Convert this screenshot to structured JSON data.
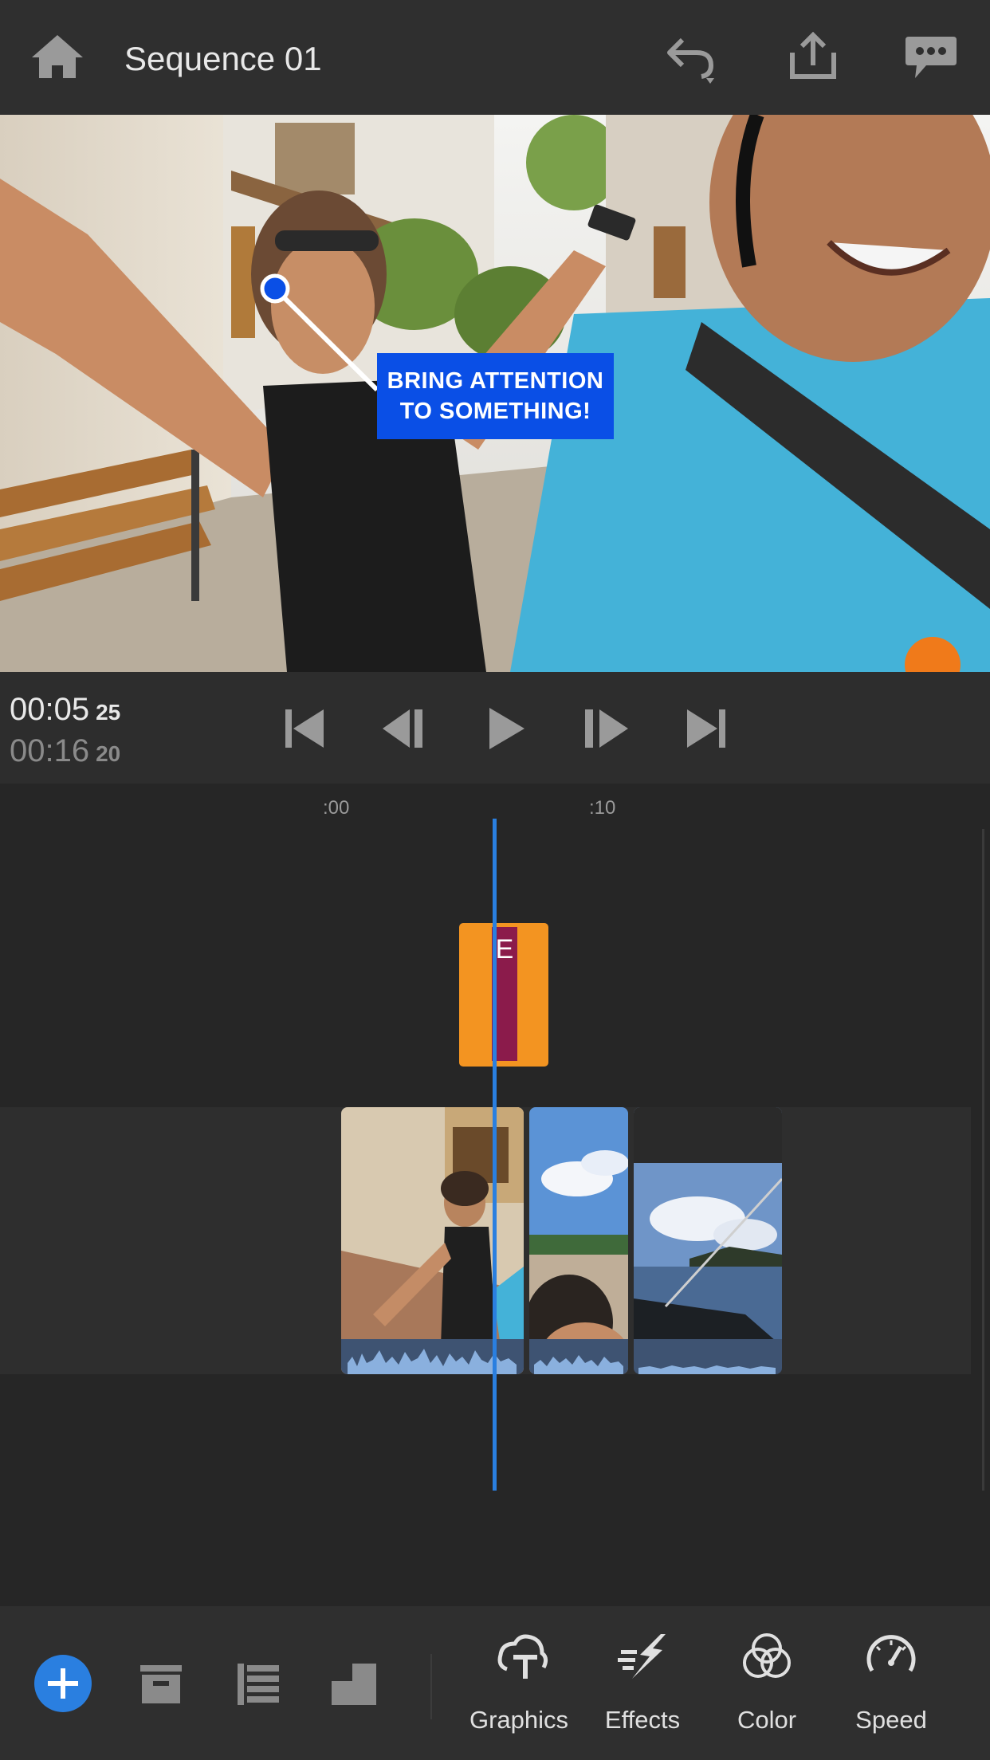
{
  "header": {
    "title": "Sequence 01",
    "icons": [
      "home-icon",
      "undo-icon",
      "share-icon",
      "feedback-icon"
    ]
  },
  "preview": {
    "callout_line1": "BRING ATTENTION",
    "callout_line2": "TO SOMETHING!",
    "callout_color": "#0a4fe6"
  },
  "transport": {
    "current_time": "00:05",
    "current_frame": "25",
    "duration_time": "00:16",
    "duration_frame": "20",
    "icons": [
      "skip-to-start-icon",
      "step-back-icon",
      "play-icon",
      "step-forward-icon",
      "skip-to-end-icon"
    ]
  },
  "timeline": {
    "ruler_labels": [
      ":00",
      ":10"
    ],
    "title_clip_label": "E",
    "playhead_color": "#2a7fe0",
    "title_clip_color": "#f39421"
  },
  "toolbar": {
    "left_icons": [
      "add-icon",
      "archive-icon",
      "layers-icon",
      "aspect-icon"
    ],
    "tools": [
      {
        "label": "Graphics",
        "icon": "graphics-icon"
      },
      {
        "label": "Effects",
        "icon": "effects-icon"
      },
      {
        "label": "Color",
        "icon": "color-icon"
      },
      {
        "label": "Speed",
        "icon": "speed-icon"
      }
    ],
    "accent": "#2a7fe0"
  }
}
